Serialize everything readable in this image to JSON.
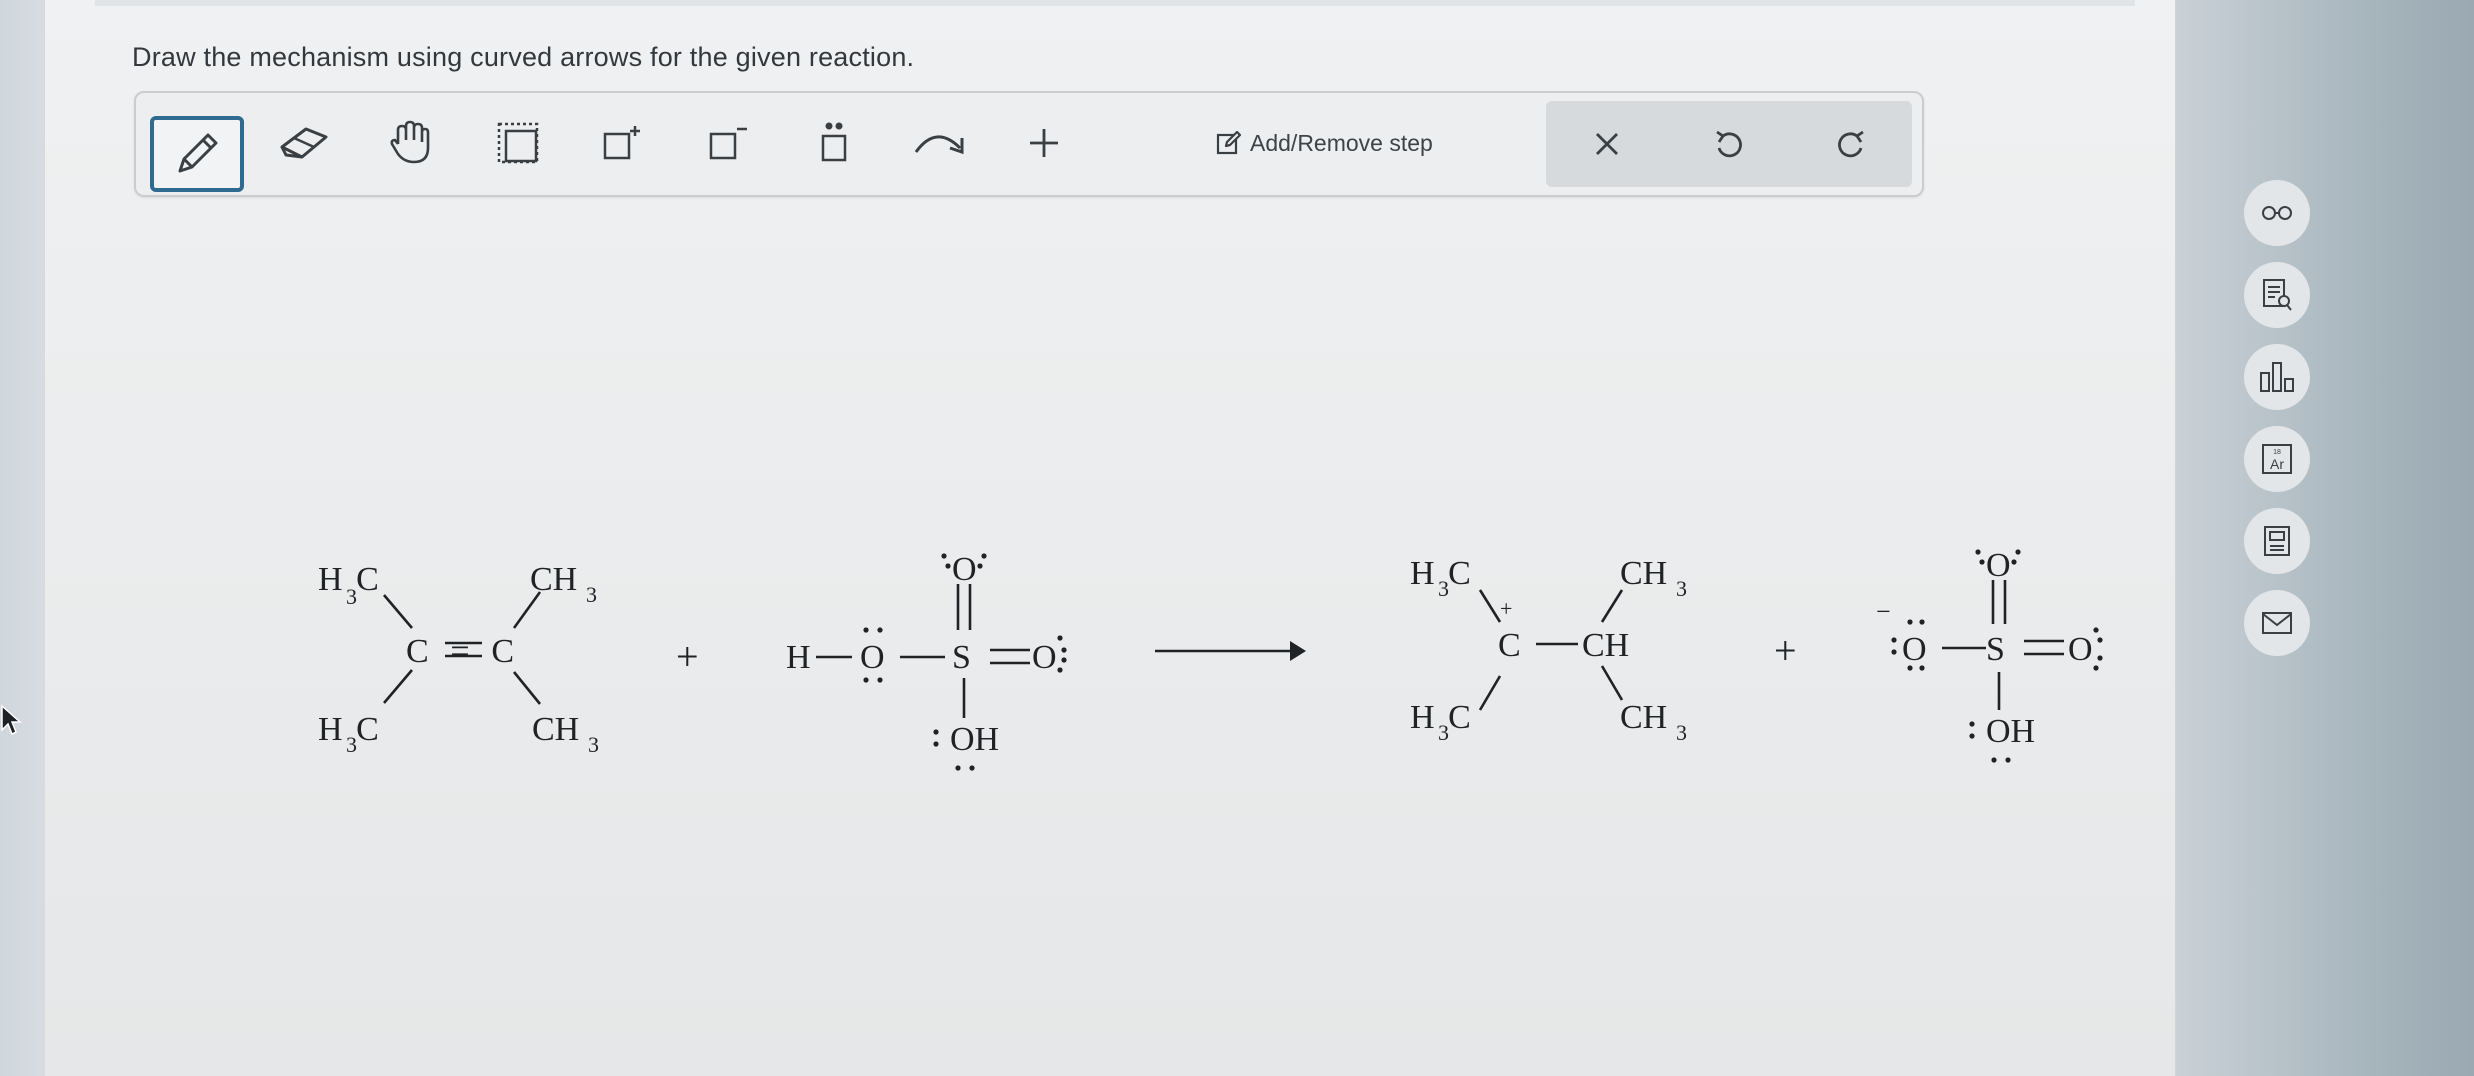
{
  "question": {
    "instruction": "Draw the mechanism using curved arrows for the given reaction."
  },
  "toolbar": {
    "tools": [
      {
        "name": "pencil-icon",
        "active": true
      },
      {
        "name": "eraser-icon"
      },
      {
        "name": "hand-icon"
      },
      {
        "name": "selection-box-icon"
      },
      {
        "name": "positive-charge-icon"
      },
      {
        "name": "negative-charge-icon"
      },
      {
        "name": "lone-pair-icon"
      },
      {
        "name": "curved-arrow-icon"
      },
      {
        "name": "plus-icon"
      }
    ],
    "add_remove_label": "Add/Remove step",
    "actions": [
      {
        "name": "close-icon"
      },
      {
        "name": "undo-icon"
      },
      {
        "name": "redo-icon"
      }
    ]
  },
  "reaction": {
    "alkene": {
      "top_left": "H3C",
      "bottom_left": "H3C",
      "double_bond": "C=C",
      "top_right": "CH3",
      "bottom_right": "CH3"
    },
    "plus_1": "+",
    "acid": {
      "h": "H",
      "o_left": "O",
      "s": "S",
      "o_top": "O",
      "o_right": "O",
      "oh": "OH"
    },
    "arrow": "→",
    "carbocation": {
      "top_left": "H3C",
      "bottom_left": "H3C",
      "center": "C",
      "charge": "+",
      "ch": "CH",
      "top_right": "CH3",
      "bottom_right": "CH3"
    },
    "plus_2": "+",
    "bisulfate": {
      "charge": "−",
      "o_left": "O",
      "s": "S",
      "o_top": "O",
      "o_right": "O",
      "oh": "OH"
    }
  },
  "sidebar": [
    {
      "name": "glasses-icon"
    },
    {
      "name": "document-search-icon"
    },
    {
      "name": "bar-chart-icon"
    },
    {
      "name": "periodic-table-icon"
    },
    {
      "name": "calculator-book-icon"
    },
    {
      "name": "mail-icon"
    }
  ]
}
